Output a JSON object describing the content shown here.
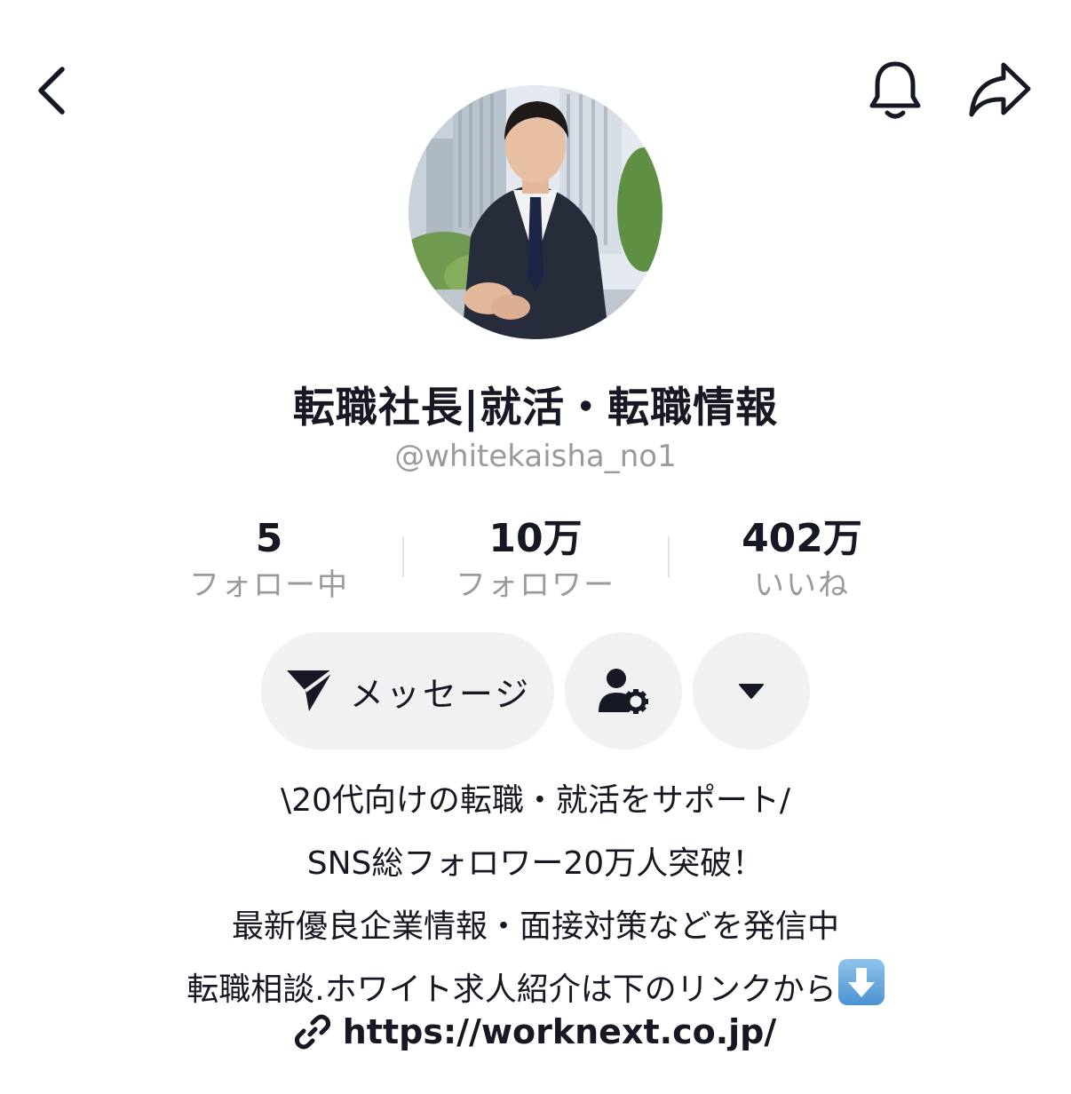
{
  "header": {
    "back_icon": "chevron-left-icon",
    "notification_icon": "bell-icon",
    "share_icon": "share-arrow-icon"
  },
  "profile": {
    "display_name": "転職社長|就活・転職情報",
    "handle": "@whitekaisha_no1"
  },
  "stats": [
    {
      "value": "5",
      "label": "フォロー中"
    },
    {
      "value": "10万",
      "label": "フォロワー"
    },
    {
      "value": "402万",
      "label": "いいね"
    }
  ],
  "actions": {
    "message_label": "メッセージ",
    "message_icon": "paper-plane-icon",
    "profile_settings_icon": "user-gear-icon",
    "more_icon": "caret-down-icon"
  },
  "bio": {
    "line1": "\\20代向けの転職・就活をサポート/",
    "line2": "SNS総フォロワー20万人突破！",
    "line3": "最新優良企業情報・面接対策などを発信中",
    "line4": "転職相談.ホワイト求人紹介は下のリンクから",
    "line4_emoji": "down-arrow-emoji"
  },
  "link": {
    "icon": "link-icon",
    "url": "https://worknext.co.jp/"
  },
  "colors": {
    "text": "#161823",
    "secondary": "#9a9a9e",
    "button_bg": "#f1f1f2"
  }
}
